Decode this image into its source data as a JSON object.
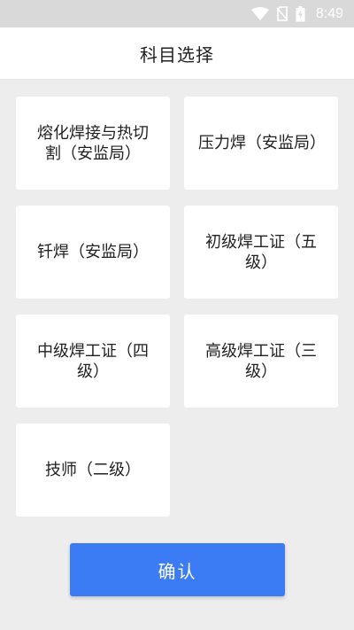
{
  "status_bar": {
    "time": "8:49",
    "icons": [
      "wifi-icon",
      "no-sim-icon",
      "battery-charging-icon"
    ]
  },
  "header": {
    "title": "科目选择"
  },
  "subjects": [
    {
      "label": "熔化焊接与热切割（安监局）"
    },
    {
      "label": "压力焊（安监局）"
    },
    {
      "label": "钎焊（安监局）"
    },
    {
      "label": "初级焊工证（五级）"
    },
    {
      "label": "中级焊工证（四级）"
    },
    {
      "label": "高级焊工证（三级）"
    },
    {
      "label": "技师（二级）"
    }
  ],
  "confirm_button": {
    "label": "确认"
  },
  "colors": {
    "accent": "#3b7bf4",
    "background": "#ededed",
    "card": "#ffffff"
  }
}
